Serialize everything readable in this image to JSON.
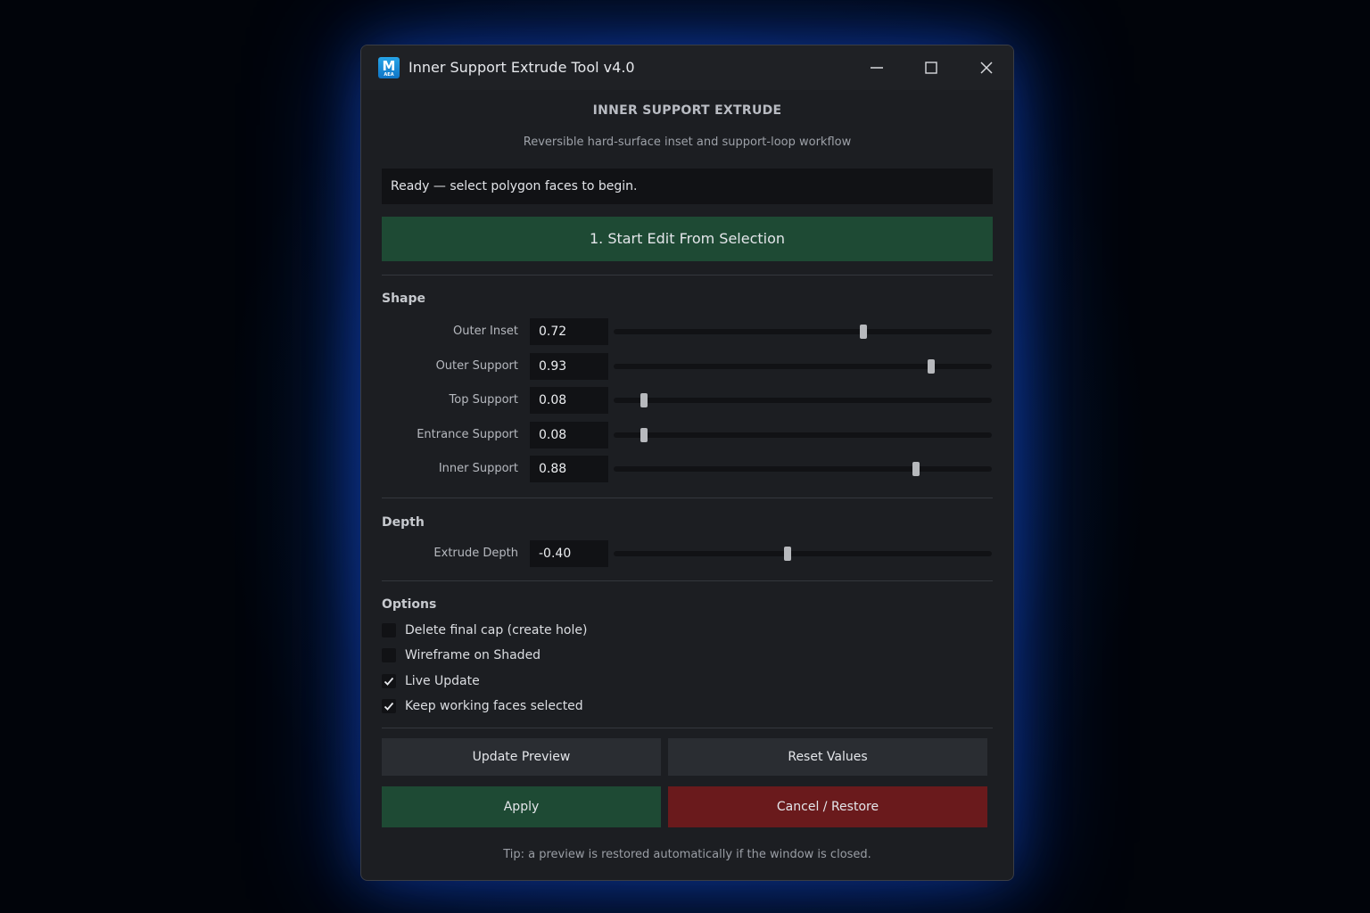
{
  "window": {
    "title": "Inner Support Extrude Tool v4.0",
    "app_icon_letter": "M",
    "app_icon_sub": "AEA"
  },
  "header": {
    "title": "INNER SUPPORT EXTRUDE",
    "subtitle": "Reversible hard-surface inset and support-loop workflow"
  },
  "status": {
    "text": "Ready — select polygon faces to begin."
  },
  "start_button": {
    "label": "1. Start Edit From Selection"
  },
  "shape": {
    "title": "Shape",
    "params": [
      {
        "label": "Outer Inset",
        "value": "0.72",
        "slider": 0.66
      },
      {
        "label": "Outer Support",
        "value": "0.93",
        "slider": 0.84
      },
      {
        "label": "Top Support",
        "value": "0.08",
        "slider": 0.08
      },
      {
        "label": "Entrance Support",
        "value": "0.08",
        "slider": 0.08
      },
      {
        "label": "Inner Support",
        "value": "0.88",
        "slider": 0.8
      }
    ]
  },
  "depth": {
    "title": "Depth",
    "params": [
      {
        "label": "Extrude Depth",
        "value": "-0.40",
        "slider": 0.46
      }
    ]
  },
  "options": {
    "title": "Options",
    "items": [
      {
        "label": "Delete final cap (create hole)",
        "checked": false
      },
      {
        "label": "Wireframe on Shaded",
        "checked": false
      },
      {
        "label": "Live Update",
        "checked": true
      },
      {
        "label": "Keep working faces selected",
        "checked": true
      }
    ]
  },
  "buttons": {
    "update_preview": "Update Preview",
    "reset_values": "Reset Values",
    "apply": "Apply",
    "cancel": "Cancel / Restore"
  },
  "tip": "Tip: a preview is restored automatically if the window is closed.",
  "colors": {
    "accent_green": "#1e4a34",
    "accent_red": "#6a1a1c",
    "app_icon_blue": "#1a8ad8"
  }
}
